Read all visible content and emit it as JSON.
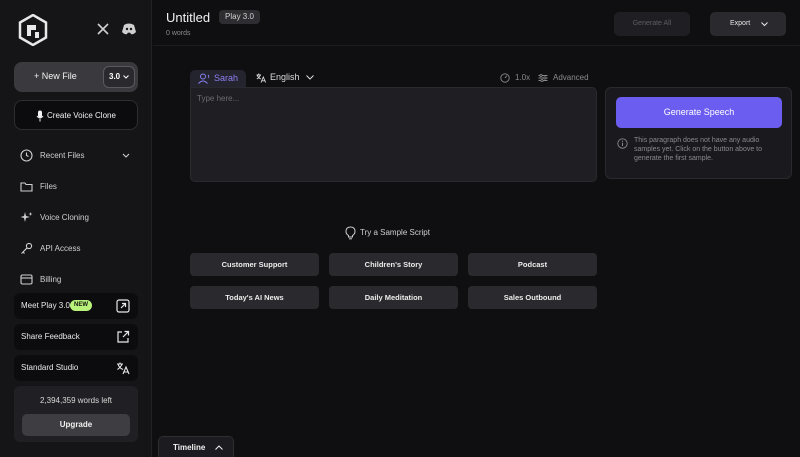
{
  "sidebar": {
    "new_file_label": "+ New File",
    "version": "3.0",
    "clone_label": "Create Voice Clone",
    "nav": [
      {
        "label": "Recent Files",
        "icon": "clock-icon"
      },
      {
        "label": "Files",
        "icon": "folder-icon"
      },
      {
        "label": "Voice Cloning",
        "icon": "sparkle-icon"
      },
      {
        "label": "API Access",
        "icon": "key-icon"
      },
      {
        "label": "Billing",
        "icon": "billing-icon"
      }
    ],
    "meet_play": "Meet Play 3.0",
    "new_badge": "NEW",
    "share_feedback": "Share Feedback",
    "standard_studio": "Standard Studio",
    "words_left": "2,394,359 words left",
    "upgrade": "Upgrade"
  },
  "header": {
    "title": "Untitled",
    "badge": "Play 3.0",
    "word_count": "0 words",
    "generate_all": "Generate All",
    "export": "Export"
  },
  "editor": {
    "voice": "Sarah",
    "language": "English",
    "speed": "1.0x",
    "advanced": "Advanced",
    "placeholder": "Type here..."
  },
  "generate": {
    "button": "Generate Speech",
    "note": "This paragraph does not have any audio samples yet. Click on the button above to generate the first sample."
  },
  "samples": {
    "heading": "Try a Sample Script",
    "items": [
      "Customer Support",
      "Children's Story",
      "Podcast",
      "Today's AI News",
      "Daily Meditation",
      "Sales Outbound"
    ]
  },
  "timeline": {
    "label": "Timeline"
  },
  "colors": {
    "accent": "#6b5df0",
    "new_badge": "#b9f27a",
    "voice_tab_text": "#8a7ff0"
  }
}
